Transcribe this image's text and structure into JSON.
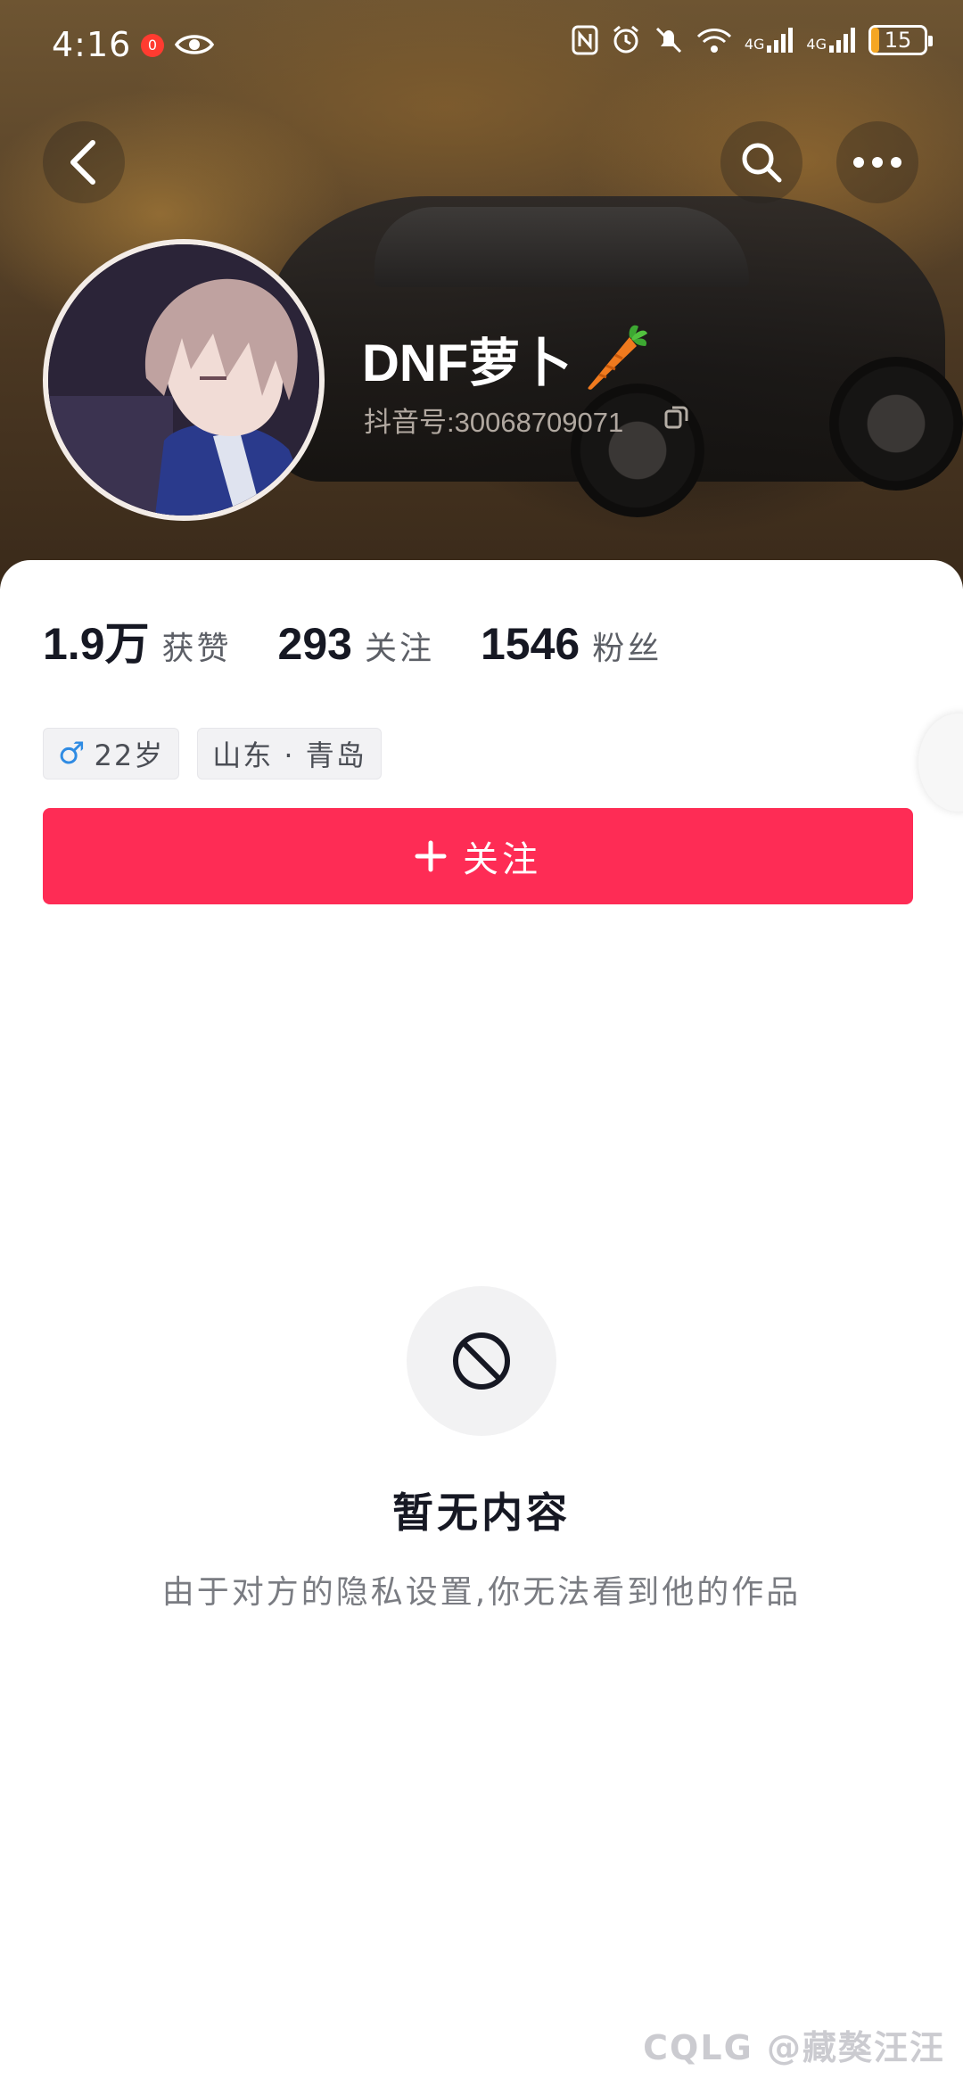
{
  "status_bar": {
    "time": "4:16",
    "notification_badge": "0",
    "network_labels": [
      "4G",
      "4G"
    ],
    "battery": "15",
    "battery_level": 0.15
  },
  "profile": {
    "nickname": "DNF萝卜",
    "douyin_id": "抖音号:30068709071"
  },
  "stats": [
    {
      "value": "1.9万",
      "label": "获赞"
    },
    {
      "value": "293",
      "label": "关注"
    },
    {
      "value": "1546",
      "label": "粉丝"
    }
  ],
  "tags": {
    "age": "22岁",
    "location": "山东 · 青岛"
  },
  "follow_button": {
    "label": "关注"
  },
  "empty_state": {
    "title": "暂无内容",
    "description": "由于对方的隐私设置,你无法看到他的作品"
  },
  "watermark": "CQLG @藏獒汪汪",
  "colors": {
    "accent": "#fe2c55",
    "male": "#2f8be3",
    "battery": "#f5a623"
  }
}
